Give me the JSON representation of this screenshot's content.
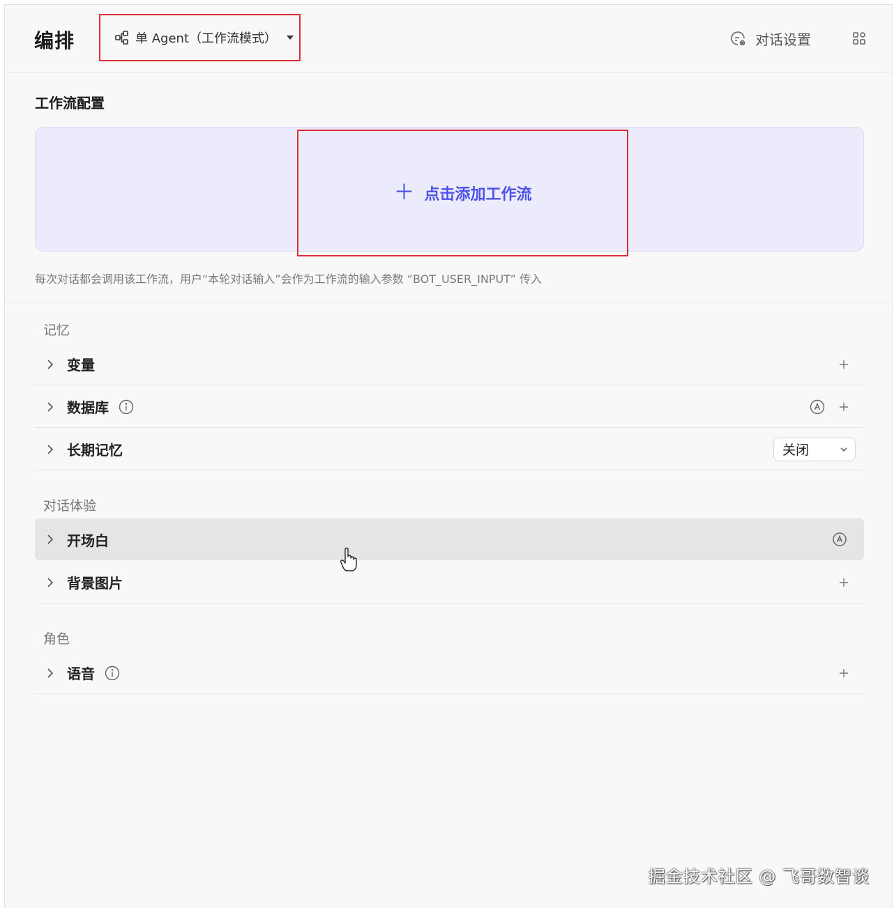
{
  "header": {
    "title": "编排",
    "mode_label": "单 Agent（工作流模式）",
    "chat_settings_label": "对话设置"
  },
  "workflow": {
    "title": "工作流配置",
    "add_label": "点击添加工作流",
    "hint": "每次对话都会调用该工作流，用户“本轮对话输入”会作为工作流的输入参数 “BOT_USER_INPUT” 传入"
  },
  "memory": {
    "title": "记忆",
    "items": [
      {
        "label": "变量"
      },
      {
        "label": "数据库"
      },
      {
        "label": "长期记忆",
        "select_value": "关闭"
      }
    ]
  },
  "experience": {
    "title": "对话体验",
    "items": [
      {
        "label": "开场白"
      },
      {
        "label": "背景图片"
      }
    ]
  },
  "role": {
    "title": "角色",
    "items": [
      {
        "label": "语音"
      }
    ]
  },
  "watermark": "掘金技术社区 @ 飞哥数智谈",
  "colors": {
    "accent": "#4d53e8",
    "highlight_border": "#e02c35",
    "dropzone_bg": "#ebebfb"
  }
}
